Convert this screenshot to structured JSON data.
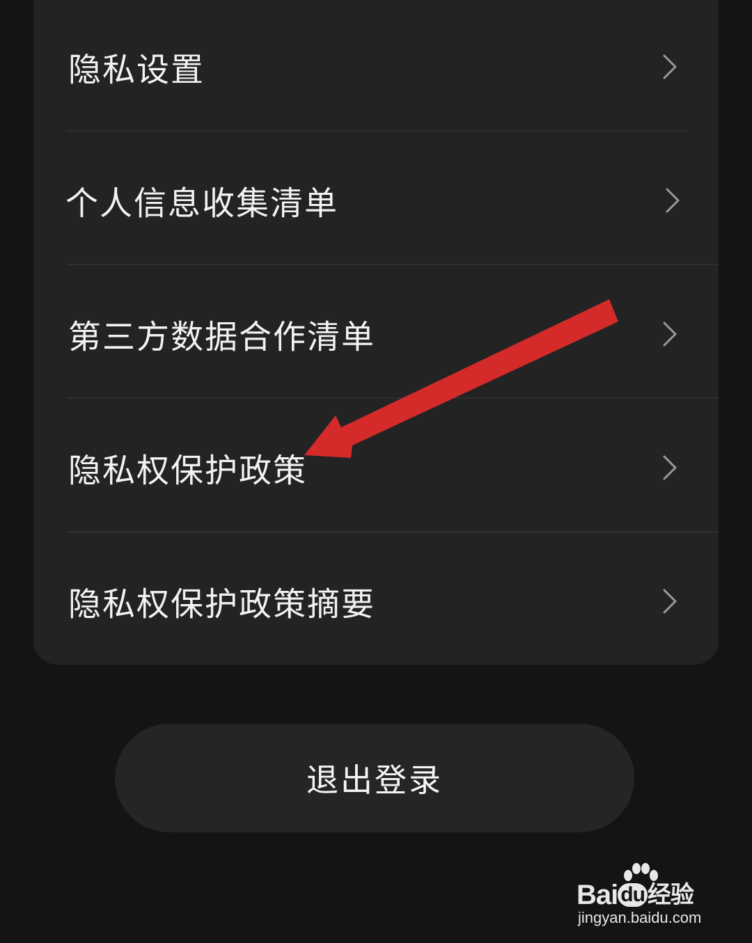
{
  "menu": {
    "items": [
      {
        "label": "隐私设置"
      },
      {
        "label": "个人信息收集清单"
      },
      {
        "label": "第三方数据合作清单"
      },
      {
        "label": "隐私权保护政策"
      },
      {
        "label": "隐私权保护政策摘要"
      }
    ],
    "chevron_icon": "chevron-right-icon"
  },
  "logout": {
    "label": "退出登录"
  },
  "annotation": {
    "arrow_color": "#d42a2a",
    "points_to": "隐私权保护政策"
  },
  "watermark": {
    "brand_prefix": "Bai",
    "brand_du": "du",
    "brand_suffix": "经验",
    "url": "jingyan.baidu.com"
  },
  "colors": {
    "background": "#141414",
    "card": "#232323",
    "button": "#252525",
    "text": "#f2f2f2"
  }
}
